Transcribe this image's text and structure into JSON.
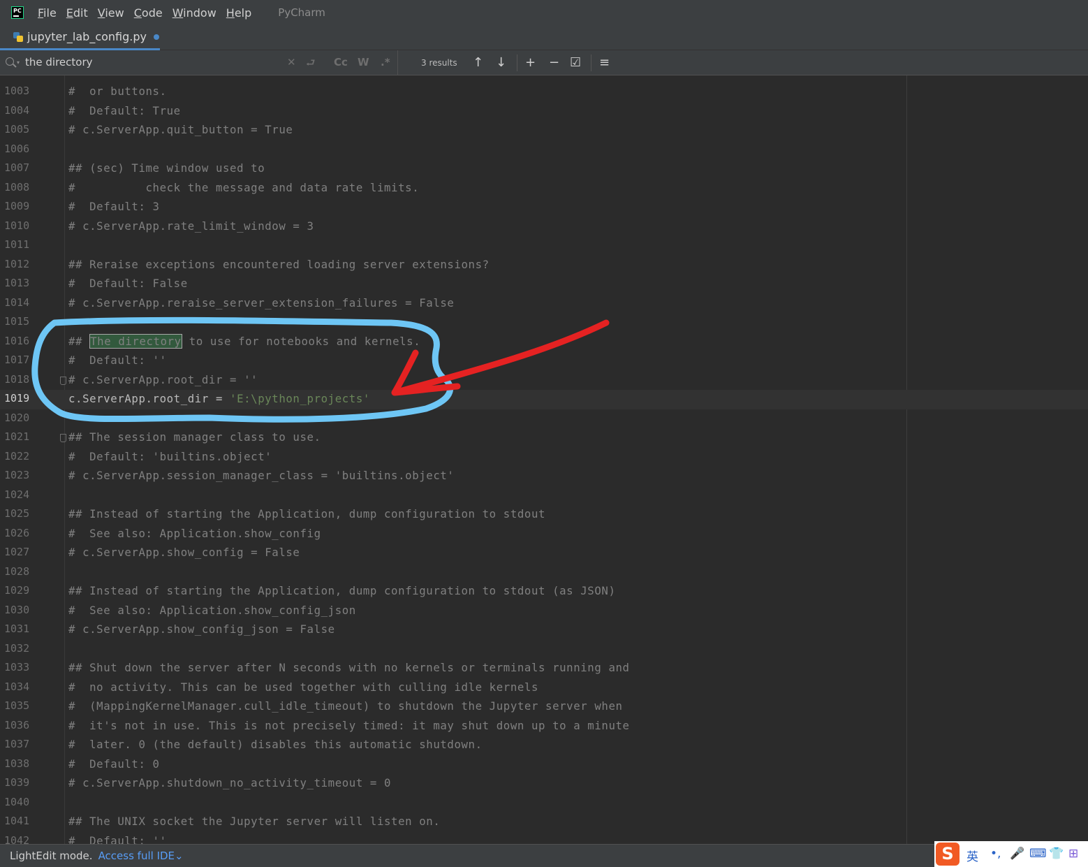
{
  "menubar": {
    "logo_text": "PC",
    "items": [
      {
        "mnemonic": "F",
        "rest": "ile"
      },
      {
        "mnemonic": "E",
        "rest": "dit"
      },
      {
        "mnemonic": "V",
        "rest": "iew"
      },
      {
        "mnemonic": "C",
        "rest": "ode"
      },
      {
        "mnemonic": "W",
        "rest": "indow"
      },
      {
        "mnemonic": "H",
        "rest": "elp"
      }
    ],
    "app_name": "PyCharm"
  },
  "tab": {
    "filename": "jupyter_lab_config.py"
  },
  "findbar": {
    "query": "the directory",
    "clear_icon": "✕",
    "newline_icon": "⮐",
    "match_case_label": "Cc",
    "words_label": "W",
    "regex_label": ".*",
    "results": "3 results",
    "prev_icon": "↑",
    "next_icon": "↓",
    "add_selection_icon": "+",
    "remove_selection_icon": "−",
    "select_all_icon": "☑",
    "filter_icon": "≡"
  },
  "editor": {
    "lines": [
      {
        "n": "1003",
        "text": "#  or buttons."
      },
      {
        "n": "1004",
        "text": "#  Default: True"
      },
      {
        "n": "1005",
        "text": "# c.ServerApp.quit_button = True"
      },
      {
        "n": "1006",
        "text": ""
      },
      {
        "n": "1007",
        "text": "## (sec) Time window used to"
      },
      {
        "n": "1008",
        "text": "#          check the message and data rate limits."
      },
      {
        "n": "1009",
        "text": "#  Default: 3"
      },
      {
        "n": "1010",
        "text": "# c.ServerApp.rate_limit_window = 3"
      },
      {
        "n": "1011",
        "text": ""
      },
      {
        "n": "1012",
        "text": "## Reraise exceptions encountered loading server extensions?"
      },
      {
        "n": "1013",
        "text": "#  Default: False"
      },
      {
        "n": "1014",
        "text": "# c.ServerApp.reraise_server_extension_failures = False"
      },
      {
        "n": "1015",
        "text": ""
      },
      {
        "n": "1016",
        "pre": "## ",
        "match": "The directory",
        "post": " to use for notebooks and kernels."
      },
      {
        "n": "1017",
        "text": "#  Default: ''"
      },
      {
        "n": "1018",
        "text": "# c.ServerApp.root_dir = ''"
      },
      {
        "n": "1019",
        "code": "c.ServerApp.root_dir = ",
        "string": "'E:\\python_projects'"
      },
      {
        "n": "1020",
        "text": ""
      },
      {
        "n": "1021",
        "text": "## The session manager class to use."
      },
      {
        "n": "1022",
        "text": "#  Default: 'builtins.object'"
      },
      {
        "n": "1023",
        "text": "# c.ServerApp.session_manager_class = 'builtins.object'"
      },
      {
        "n": "1024",
        "text": ""
      },
      {
        "n": "1025",
        "text": "## Instead of starting the Application, dump configuration to stdout"
      },
      {
        "n": "1026",
        "text": "#  See also: Application.show_config"
      },
      {
        "n": "1027",
        "text": "# c.ServerApp.show_config = False"
      },
      {
        "n": "1028",
        "text": ""
      },
      {
        "n": "1029",
        "text": "## Instead of starting the Application, dump configuration to stdout (as JSON)"
      },
      {
        "n": "1030",
        "text": "#  See also: Application.show_config_json"
      },
      {
        "n": "1031",
        "text": "# c.ServerApp.show_config_json = False"
      },
      {
        "n": "1032",
        "text": ""
      },
      {
        "n": "1033",
        "text": "## Shut down the server after N seconds with no kernels or terminals running and"
      },
      {
        "n": "1034",
        "text": "#  no activity. This can be used together with culling idle kernels"
      },
      {
        "n": "1035",
        "text": "#  (MappingKernelManager.cull_idle_timeout) to shutdown the Jupyter server when"
      },
      {
        "n": "1036",
        "text": "#  it's not in use. This is not precisely timed: it may shut down up to a minute"
      },
      {
        "n": "1037",
        "text": "#  later. 0 (the default) disables this automatic shutdown."
      },
      {
        "n": "1038",
        "text": "#  Default: 0"
      },
      {
        "n": "1039",
        "text": "# c.ServerApp.shutdown_no_activity_timeout = 0"
      },
      {
        "n": "1040",
        "text": ""
      },
      {
        "n": "1041",
        "text": "## The UNIX socket the Jupyter server will listen on."
      },
      {
        "n": "1042",
        "text": "#  Default: ''"
      }
    ]
  },
  "statusbar": {
    "mode": "LightEdit mode.",
    "link": "Access full IDE",
    "link_chevron": "⌄"
  },
  "ime": {
    "logo": "S",
    "lang": "英",
    "punct": "•,",
    "mic": "🎤",
    "keyboard": "⌨",
    "shirt": "👕",
    "grid": "⊞"
  },
  "colors": {
    "annotation_circle": "#6ec6f5",
    "annotation_arrow": "#e52222",
    "match_highlight": "#32593d",
    "string_literal": "#6a8759"
  }
}
